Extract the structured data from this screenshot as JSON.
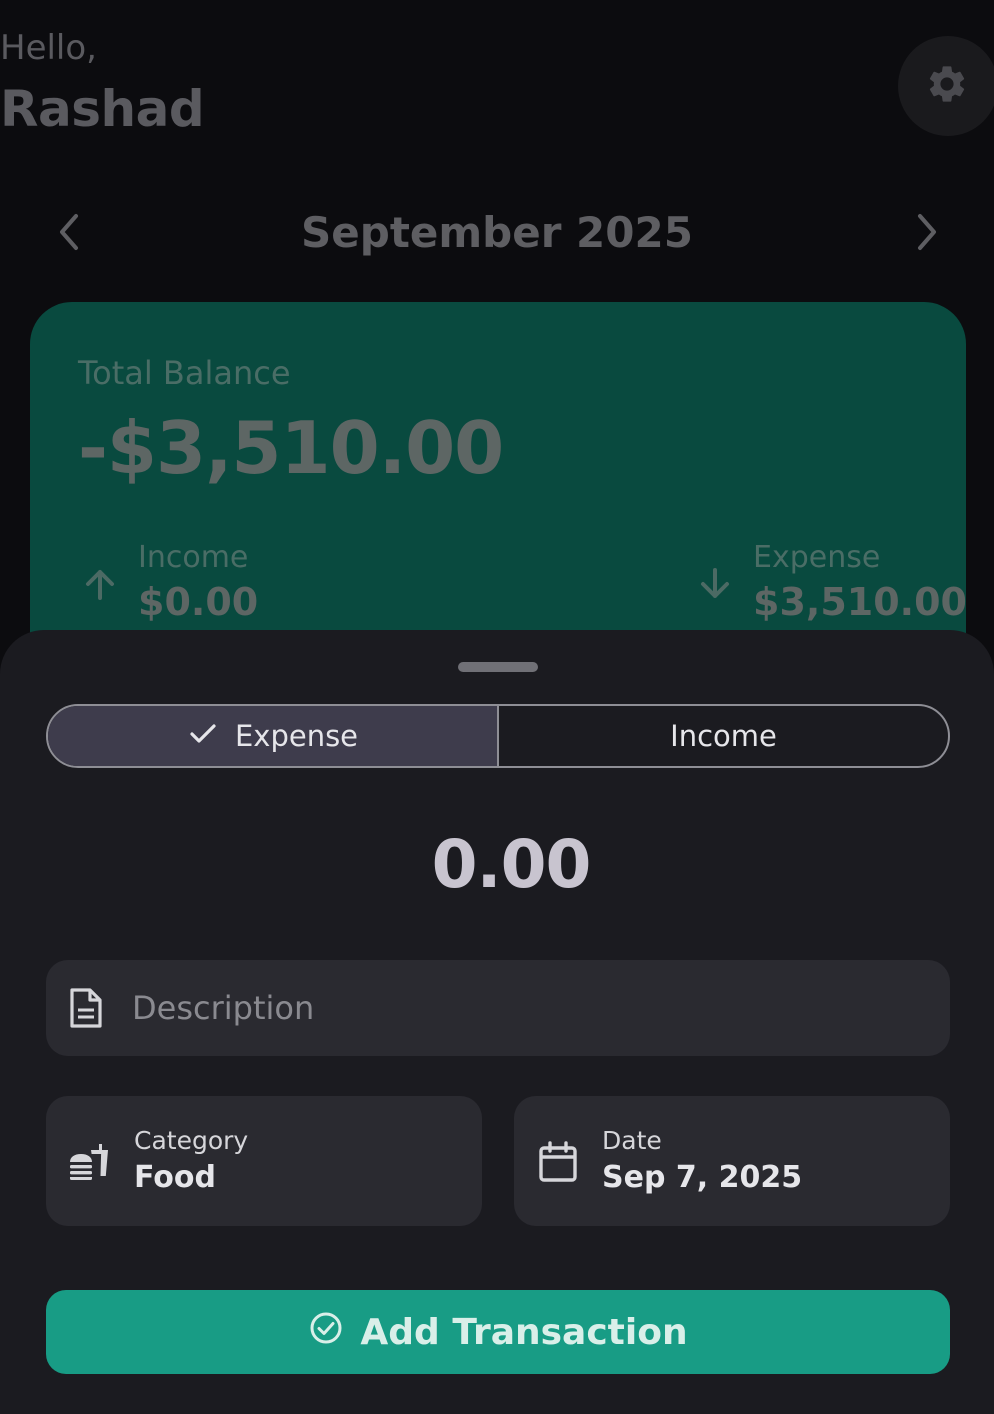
{
  "header": {
    "greeting": "Hello,",
    "user_name": "Rashad",
    "settings_icon": "gear-icon"
  },
  "month_nav": {
    "title": "September 2025",
    "prev_icon": "chevron-left-icon",
    "next_icon": "chevron-right-icon"
  },
  "balance_card": {
    "label": "Total Balance",
    "value": "-$3,510.00",
    "income_label": "Income",
    "income_value": "$0.00",
    "expense_label": "Expense",
    "expense_value": "$3,510.00",
    "color": "#094a3f"
  },
  "sheet": {
    "segments": [
      {
        "label": "Expense",
        "selected": true
      },
      {
        "label": "Income",
        "selected": false
      }
    ],
    "amount": "0.00",
    "description": {
      "placeholder": "Description",
      "value": ""
    },
    "category": {
      "label": "Category",
      "value": "Food",
      "icon": "fastfood-icon"
    },
    "date": {
      "label": "Date",
      "value": "Sep 7, 2025",
      "icon": "calendar-icon"
    },
    "submit_label": "Add Transaction",
    "accent_color": "#189c85"
  }
}
